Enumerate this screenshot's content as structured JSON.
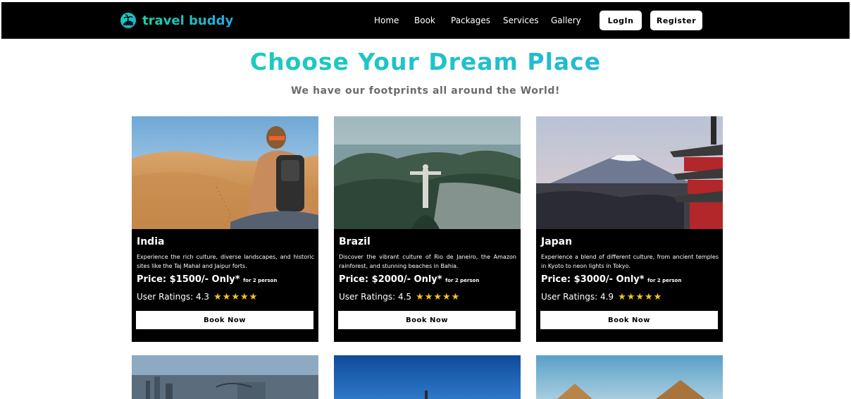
{
  "brand": {
    "name": "travel buddy"
  },
  "nav": {
    "items": [
      "Home",
      "Book",
      "Packages",
      "Services",
      "Gallery"
    ]
  },
  "auth": {
    "login": "LogIn",
    "register": "Register"
  },
  "hero": {
    "title": "Choose Your Dream Place",
    "subtitle": "We have our footprints all around the World!"
  },
  "cards": [
    {
      "name": "India",
      "description": "Experience the rich culture, diverse landscapes, and historic sites like the Taj Mahal and Jaipur forts.",
      "price": "Price: $1500/- Only*",
      "price_note": "for 2 person",
      "rating_label": "User Ratings: 4.3",
      "stars": "★★★★★",
      "button": "Book Now"
    },
    {
      "name": "Brazil",
      "description": "Discover the vibrant culture of Rio de Janeiro, the Amazon rainforest, and stunning beaches in Bahia.",
      "price": "Price: $2000/- Only*",
      "price_note": "for 2 person",
      "rating_label": "User Ratings: 4.5",
      "stars": "★★★★★",
      "button": "Book Now"
    },
    {
      "name": "Japan",
      "description": "Experience a blend of different culture, from ancient temples in Kyoto to neon lights in Tokyo.",
      "price": "Price: $3000/- Only*",
      "price_note": "for 2 person",
      "rating_label": "User Ratings: 4.9",
      "stars": "★★★★★",
      "button": "Book Now"
    }
  ],
  "colors": {
    "accent_start": "#15d7a7",
    "accent_end": "#2aa9e4",
    "star": "#f5c518"
  }
}
